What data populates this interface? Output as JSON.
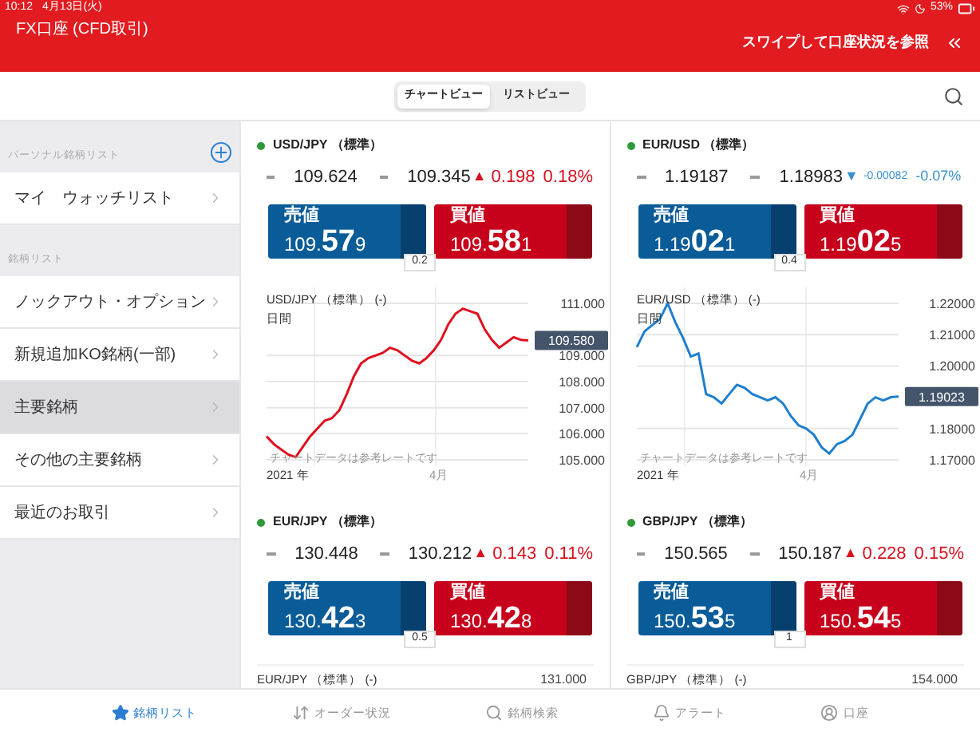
{
  "status_bar": {
    "time": "10:12",
    "date": "4月13日(火)",
    "battery": "53%"
  },
  "header": {
    "title": "FX口座 (CFD取引)",
    "swipe_hint": "スワイプして口座状況を参照"
  },
  "view_tabs": [
    {
      "label": "チャートビュー",
      "selected": true
    },
    {
      "label": "リストビュー",
      "selected": false
    }
  ],
  "sidebar": {
    "sections": [
      {
        "title": "パーソナル銘柄リスト",
        "add_button": true,
        "items": [
          {
            "label": "マイ　ウォッチリスト",
            "selected": false
          }
        ]
      },
      {
        "title": "銘柄リスト",
        "items": [
          {
            "label": "ノックアウト・オプション",
            "selected": false
          },
          {
            "label": "新規追加KO銘柄(一部)",
            "selected": false
          },
          {
            "label": "主要銘柄",
            "selected": true
          },
          {
            "label": "その他の主要銘柄",
            "selected": false
          },
          {
            "label": "最近のお取引",
            "selected": false
          }
        ]
      }
    ]
  },
  "cards": [
    {
      "pair": "USD/JPY （標準）",
      "high": "109.624",
      "low": "109.345",
      "kind": "up",
      "arrow": "▲",
      "change": "0.198",
      "percent": "0.18%",
      "sell": {
        "label": "売値",
        "head": "109.",
        "big": "57",
        "tail": "9"
      },
      "buy": {
        "label": "買値",
        "head": "109.",
        "big": "58",
        "tail": "1"
      },
      "spread": "0.2",
      "chart": {
        "title": "USD/JPY （標準） (-)",
        "period": "日間",
        "note": "チャートデータは参考レートです",
        "year_label": "2021 年",
        "month_label": "4月",
        "current": "109.580",
        "chart_data": {
          "type": "line",
          "grid": true,
          "ylim": [
            105,
            111
          ],
          "yticks": [
            {
              "value": 105,
              "label": "105.000"
            },
            {
              "value": 106,
              "label": "106.000"
            },
            {
              "value": 107,
              "label": "107.000"
            },
            {
              "value": 108,
              "label": "108.000"
            },
            {
              "value": 109,
              "label": "109.000"
            },
            {
              "value": 111,
              "label": "111.000"
            }
          ],
          "series": [
            {
              "color": "#e0101e",
              "values": [
                105.9,
                105.6,
                105.4,
                105.2,
                105.1,
                105.5,
                105.9,
                106.2,
                106.5,
                106.6,
                106.9,
                107.5,
                108.2,
                108.7,
                108.9,
                109.0,
                109.1,
                109.3,
                109.2,
                109.0,
                108.8,
                108.7,
                108.9,
                109.2,
                109.6,
                110.2,
                110.6,
                110.8,
                110.7,
                110.6,
                110.0,
                109.6,
                109.3,
                109.5,
                109.7,
                109.6,
                109.58
              ]
            }
          ]
        }
      }
    },
    {
      "pair": "EUR/USD （標準）",
      "high": "1.19187",
      "low": "1.18983",
      "kind": "down",
      "arrow": "▼",
      "change": "-0.00082",
      "percent": "-0.07%",
      "sell": {
        "label": "売値",
        "head": "1.19",
        "big": "02",
        "tail": "1"
      },
      "buy": {
        "label": "買値",
        "head": "1.19",
        "big": "02",
        "tail": "5"
      },
      "spread": "0.4",
      "chart": {
        "title": "EUR/USD （標準） (-)",
        "period": "日間",
        "note": "チャートデータは参考レートです",
        "year_label": "2021 年",
        "month_label": "4月",
        "current": "1.19023",
        "chart_data": {
          "type": "line",
          "grid": true,
          "ylim": [
            1.17,
            1.22
          ],
          "yticks": [
            {
              "value": 1.17,
              "label": "1.17000"
            },
            {
              "value": 1.18,
              "label": "1.18000"
            },
            {
              "value": 1.2,
              "label": "1.20000"
            },
            {
              "value": 1.21,
              "label": "1.21000"
            },
            {
              "value": 1.22,
              "label": "1.22000"
            }
          ],
          "series": [
            {
              "color": "#1f7fd0",
              "values": [
                1.206,
                1.211,
                1.213,
                1.215,
                1.22,
                1.214,
                1.209,
                1.203,
                1.204,
                1.191,
                1.19,
                1.188,
                1.191,
                1.194,
                1.193,
                1.191,
                1.19,
                1.189,
                1.19,
                1.188,
                1.184,
                1.181,
                1.18,
                1.178,
                1.174,
                1.172,
                1.175,
                1.176,
                1.178,
                1.183,
                1.188,
                1.19,
                1.189,
                1.19,
                1.1902
              ]
            }
          ]
        }
      }
    },
    {
      "pair": "EUR/JPY （標準）",
      "high": "130.448",
      "low": "130.212",
      "kind": "up",
      "arrow": "▲",
      "change": "0.143",
      "percent": "0.11%",
      "sell": {
        "label": "売値",
        "head": "130.",
        "big": "42",
        "tail": "3"
      },
      "buy": {
        "label": "買値",
        "head": "130.",
        "big": "42",
        "tail": "8"
      },
      "spread": "0.5",
      "chart_preview": {
        "title": "EUR/JPY （標準） (-)",
        "top_tick": "131.000"
      }
    },
    {
      "pair": "GBP/JPY （標準）",
      "high": "150.565",
      "low": "150.187",
      "kind": "up",
      "arrow": "▲",
      "change": "0.228",
      "percent": "0.15%",
      "sell": {
        "label": "売値",
        "head": "150.",
        "big": "53",
        "tail": "5"
      },
      "buy": {
        "label": "買値",
        "head": "150.",
        "big": "54",
        "tail": "5"
      },
      "spread": "1",
      "chart_preview": {
        "title": "GBP/JPY （標準） (-)",
        "top_tick": "154.000"
      }
    }
  ],
  "bottom_nav": [
    {
      "label": "銘柄リスト",
      "selected": true,
      "kind": "star"
    },
    {
      "label": "オーダー状況",
      "selected": false,
      "kind": "orders"
    },
    {
      "label": "銘柄検索",
      "selected": false,
      "kind": "search"
    },
    {
      "label": "アラート",
      "selected": false,
      "kind": "bell"
    },
    {
      "label": "口座",
      "selected": false,
      "kind": "account"
    }
  ]
}
